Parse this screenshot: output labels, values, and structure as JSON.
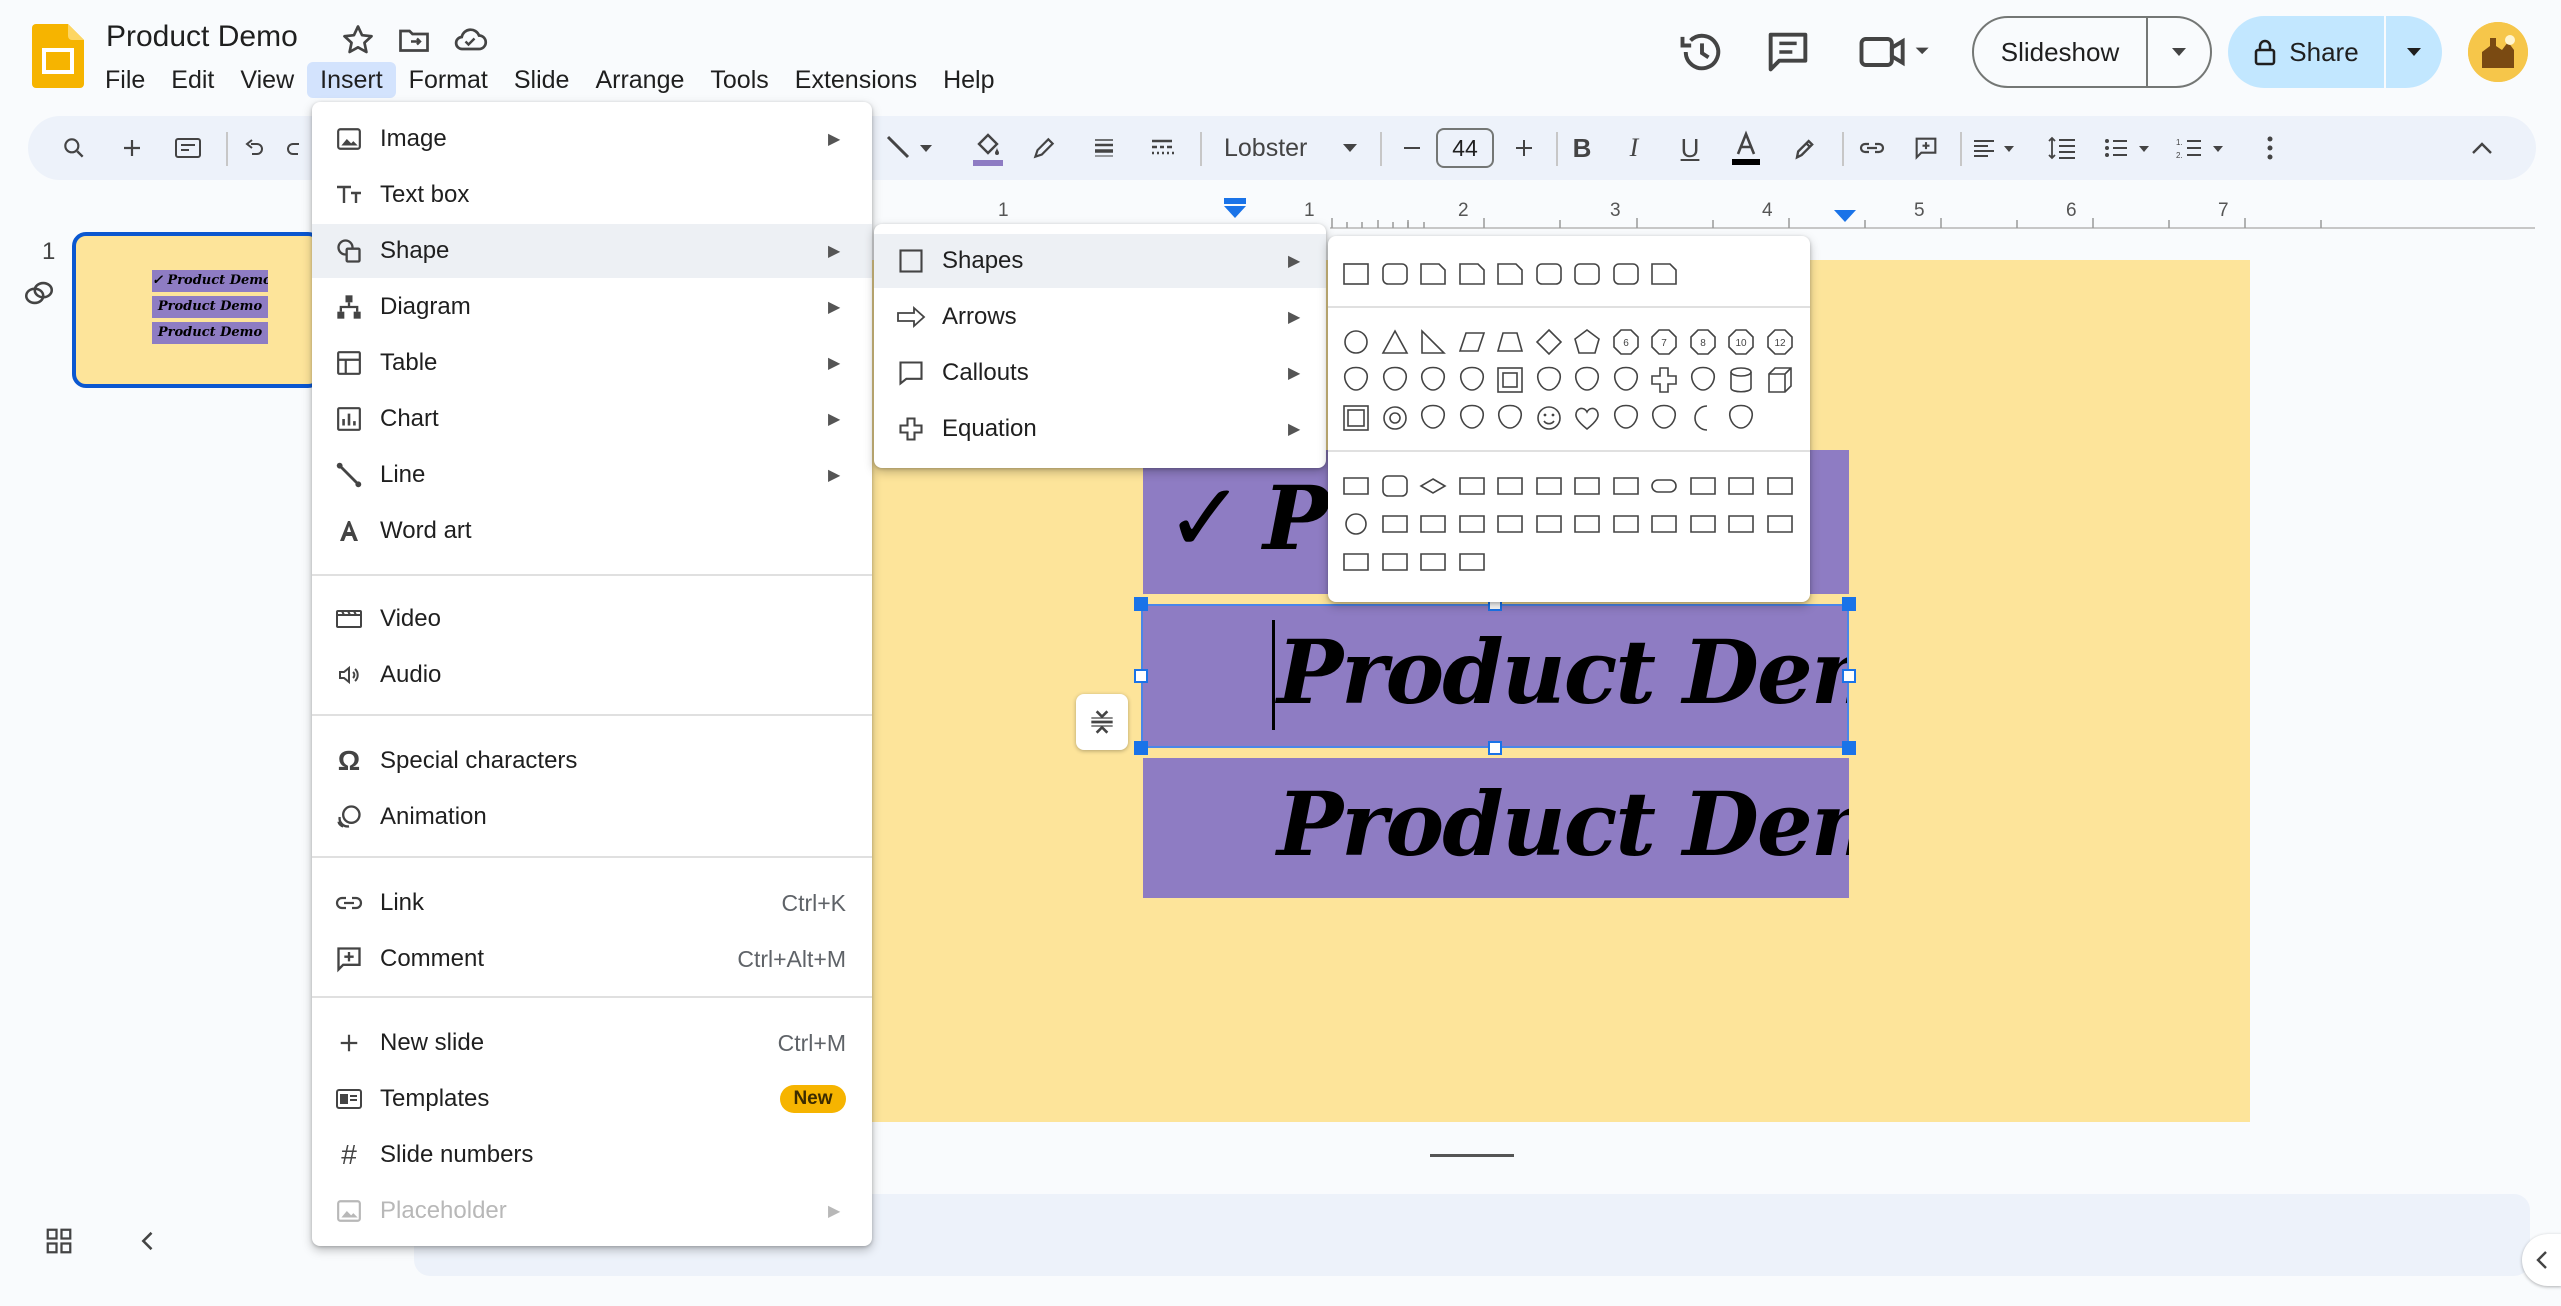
{
  "app": {
    "doc_title": "Product Demo"
  },
  "menubar": [
    "File",
    "Edit",
    "View",
    "Insert",
    "Format",
    "Slide",
    "Arrange",
    "Tools",
    "Extensions",
    "Help"
  ],
  "header": {
    "slideshow_label": "Slideshow",
    "share_label": "Share"
  },
  "toolbar": {
    "font_name": "Lobster",
    "font_size": "44"
  },
  "filmstrip": {
    "slide_number": "1",
    "thumb_texts": [
      "✓ Product Demo",
      "Product Demo",
      "Product Demo"
    ]
  },
  "ruler": {
    "left_label": "1",
    "labels": [
      "1",
      "2",
      "3",
      "4",
      "5",
      "6",
      "7"
    ]
  },
  "slide": {
    "check_mark": "✓",
    "box1_text": "Pr",
    "box2_text": "Product Demo",
    "box3_text": "Product Demo",
    "colors": {
      "background": "#fde49a",
      "box": "#8e7cc3",
      "selection": "#1a73e8"
    }
  },
  "insert_menu": {
    "items": [
      {
        "label": "Image",
        "icon": "image-icon",
        "submenu": true
      },
      {
        "label": "Text box",
        "icon": "text-box-icon"
      },
      {
        "label": "Shape",
        "icon": "shape-icon",
        "submenu": true
      },
      {
        "label": "Diagram",
        "icon": "diagram-icon",
        "submenu": true
      },
      {
        "label": "Table",
        "icon": "table-icon",
        "submenu": true
      },
      {
        "label": "Chart",
        "icon": "chart-icon",
        "submenu": true
      },
      {
        "label": "Line",
        "icon": "line-icon",
        "submenu": true
      },
      {
        "label": "Word art",
        "icon": "word-art-icon"
      },
      {
        "label": "Video",
        "icon": "video-icon"
      },
      {
        "label": "Audio",
        "icon": "audio-icon"
      },
      {
        "label": "Special characters",
        "icon": "omega-icon"
      },
      {
        "label": "Animation",
        "icon": "animation-icon"
      },
      {
        "label": "Link",
        "icon": "link-icon",
        "shortcut": "Ctrl+K"
      },
      {
        "label": "Comment",
        "icon": "comment-icon",
        "shortcut": "Ctrl+Alt+M"
      },
      {
        "label": "New slide",
        "icon": "plus-icon",
        "shortcut": "Ctrl+M"
      },
      {
        "label": "Templates",
        "icon": "templates-icon",
        "badge": "New"
      },
      {
        "label": "Slide numbers",
        "icon": "hash-icon"
      },
      {
        "label": "Placeholder",
        "icon": "placeholder-icon",
        "submenu": true,
        "disabled": true
      }
    ]
  },
  "shape_submenu": {
    "items": [
      {
        "label": "Shapes",
        "icon": "square-icon"
      },
      {
        "label": "Arrows",
        "icon": "arrow-icon"
      },
      {
        "label": "Callouts",
        "icon": "callout-icon"
      },
      {
        "label": "Equation",
        "icon": "equation-icon"
      }
    ]
  },
  "shapes_palette": {
    "rows": [
      [
        "rectangle",
        "rounded-rectangle",
        "snip-corner",
        "snip-same-side",
        "snip-diagonal",
        "round-corner",
        "round-same-side",
        "round-diagonal",
        "snip-round"
      ],
      [
        "oval",
        "triangle",
        "right-triangle",
        "parallelogram",
        "trapezoid",
        "diamond",
        "pentagon",
        "hexagon",
        "heptagon",
        "octagon",
        "decagon",
        "dodecagon"
      ],
      [
        "pie",
        "arc",
        "teardrop",
        "chord",
        "frame",
        "half-frame",
        "l-shape",
        "diagonal-stripe",
        "plus",
        "plaque",
        "can",
        "cube"
      ],
      [
        "bevel",
        "donut",
        "no-symbol",
        "block-arc",
        "folded-corner",
        "smiley",
        "heart",
        "lightning",
        "sun",
        "moon",
        "cloud"
      ],
      [
        "flow-process",
        "flow-alt-process",
        "flow-decision",
        "flow-data",
        "flow-predefined",
        "flow-internal-storage",
        "flow-document",
        "flow-multidocument",
        "flow-terminator",
        "flow-preparation",
        "flow-manual-input",
        "flow-manual-operation"
      ],
      [
        "flow-connector",
        "flow-offpage",
        "flow-card",
        "flow-punched-tape",
        "flow-summing",
        "flow-or",
        "flow-collate",
        "flow-sort",
        "flow-extract",
        "flow-merge",
        "flow-stored-data",
        "flow-delay"
      ],
      [
        "flow-sequential-access",
        "flow-magnetic-disk",
        "flow-direct-access",
        "flow-display"
      ]
    ],
    "numbered_labels": [
      "6",
      "7",
      "8",
      "10",
      "12"
    ]
  }
}
